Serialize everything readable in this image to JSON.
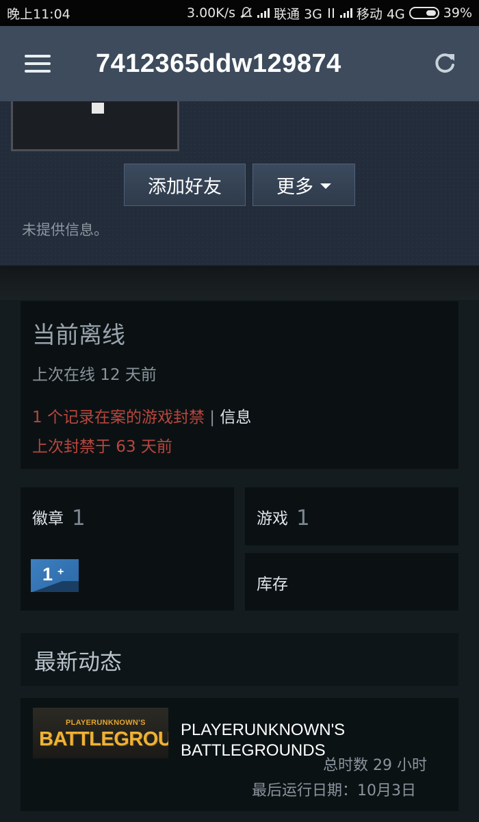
{
  "status_bar": {
    "time": "晚上11:04",
    "speed": "3.00K/s",
    "carrier1": "联通 3G",
    "carrier2": "移动 4G",
    "battery": "39%",
    "icons": [
      "mute-bell-icon",
      "signal-icon",
      "data-arrows-icon",
      "battery-icon"
    ]
  },
  "app_bar": {
    "title": "7412365ddw129874",
    "icons": [
      "menu-icon",
      "refresh-icon"
    ]
  },
  "profile": {
    "add_friend_label": "添加好友",
    "more_label": "更多",
    "summary": "未提供信息。"
  },
  "status": {
    "title": "当前离线",
    "last_online": "上次在线 12 天前",
    "ban_text": "1 个记录在案的游戏封禁",
    "ban_separator": "|",
    "ban_info_link": "信息",
    "last_ban": "上次封禁于 63 天前"
  },
  "stats": {
    "badges_label": "徽章",
    "badges_count": "1",
    "badge_icon_text": "1",
    "badge_icon_plus": "+",
    "games_label": "游戏",
    "games_count": "1",
    "inventory_label": "库存"
  },
  "activity": {
    "title": "最新动态",
    "game": {
      "thumb_small": "PLAYERUNKNOWN'S",
      "thumb_big": "BATTLEGROUNDS",
      "name_line1": "PLAYERUNKNOWN'S",
      "name_line2": "BATTLEGROUNDS",
      "hours": "总时数 29 小时",
      "last_played": "最后运行日期：10月3日"
    }
  },
  "colors": {
    "app_bar_bg": "#3d4b5c",
    "panel_bg": "#0b1113",
    "ban_red": "#b8463e",
    "badge_blue": "#3d7fbf",
    "pubg_gold": "#efb237"
  }
}
